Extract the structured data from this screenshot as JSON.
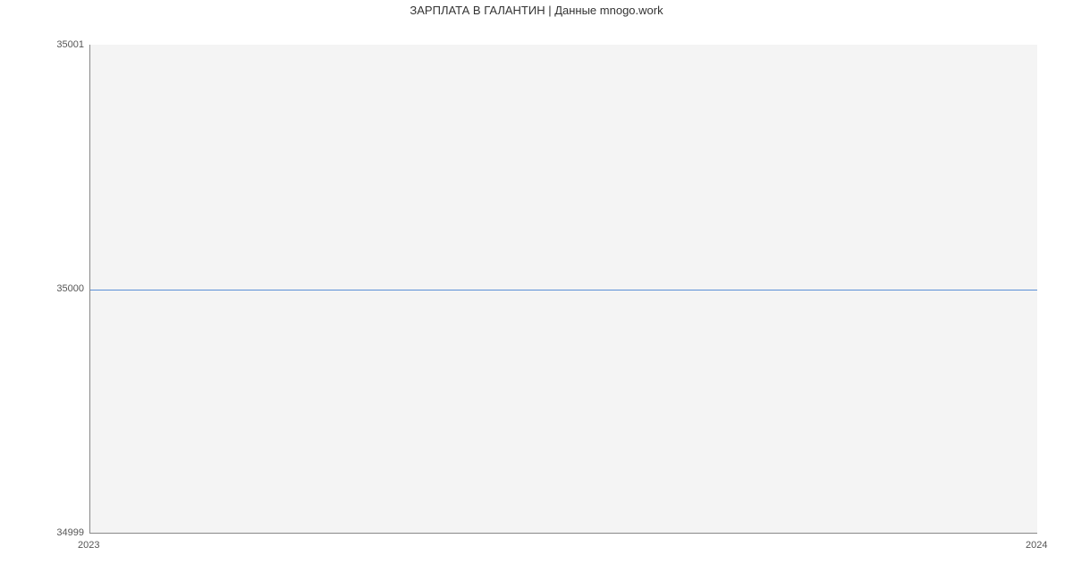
{
  "title": "ЗАРПЛАТА В ГАЛАНТИН | Данные mnogo.work",
  "y_ticks": [
    "35001",
    "35000",
    "34999"
  ],
  "x_ticks": [
    "2023",
    "2024"
  ],
  "colors": {
    "line": "#5b8fd6"
  },
  "chart_data": {
    "type": "line",
    "x": [
      2023,
      2024
    ],
    "values": [
      35000,
      35000
    ],
    "title": "ЗАРПЛАТА В ГАЛАНТИН | Данные mnogo.work",
    "xlabel": "",
    "ylabel": "",
    "xlim": [
      2023,
      2024
    ],
    "ylim": [
      34999,
      35001
    ]
  }
}
